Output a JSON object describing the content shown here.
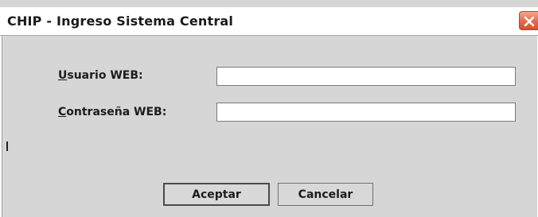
{
  "window": {
    "title": "CHIP - Ingreso Sistema Central"
  },
  "form": {
    "user_label_mnemonic": "U",
    "user_label_rest": "suario WEB:",
    "user_value": "",
    "password_label_mnemonic": "C",
    "password_label_rest": "ontraseña WEB:",
    "password_value": ""
  },
  "buttons": {
    "accept_label": "Aceptar",
    "cancel_label": "Cancelar"
  },
  "icons": {
    "close": "close-icon"
  },
  "colors": {
    "dialog_background": "#d6d6d6",
    "close_button": "#e2694b"
  }
}
